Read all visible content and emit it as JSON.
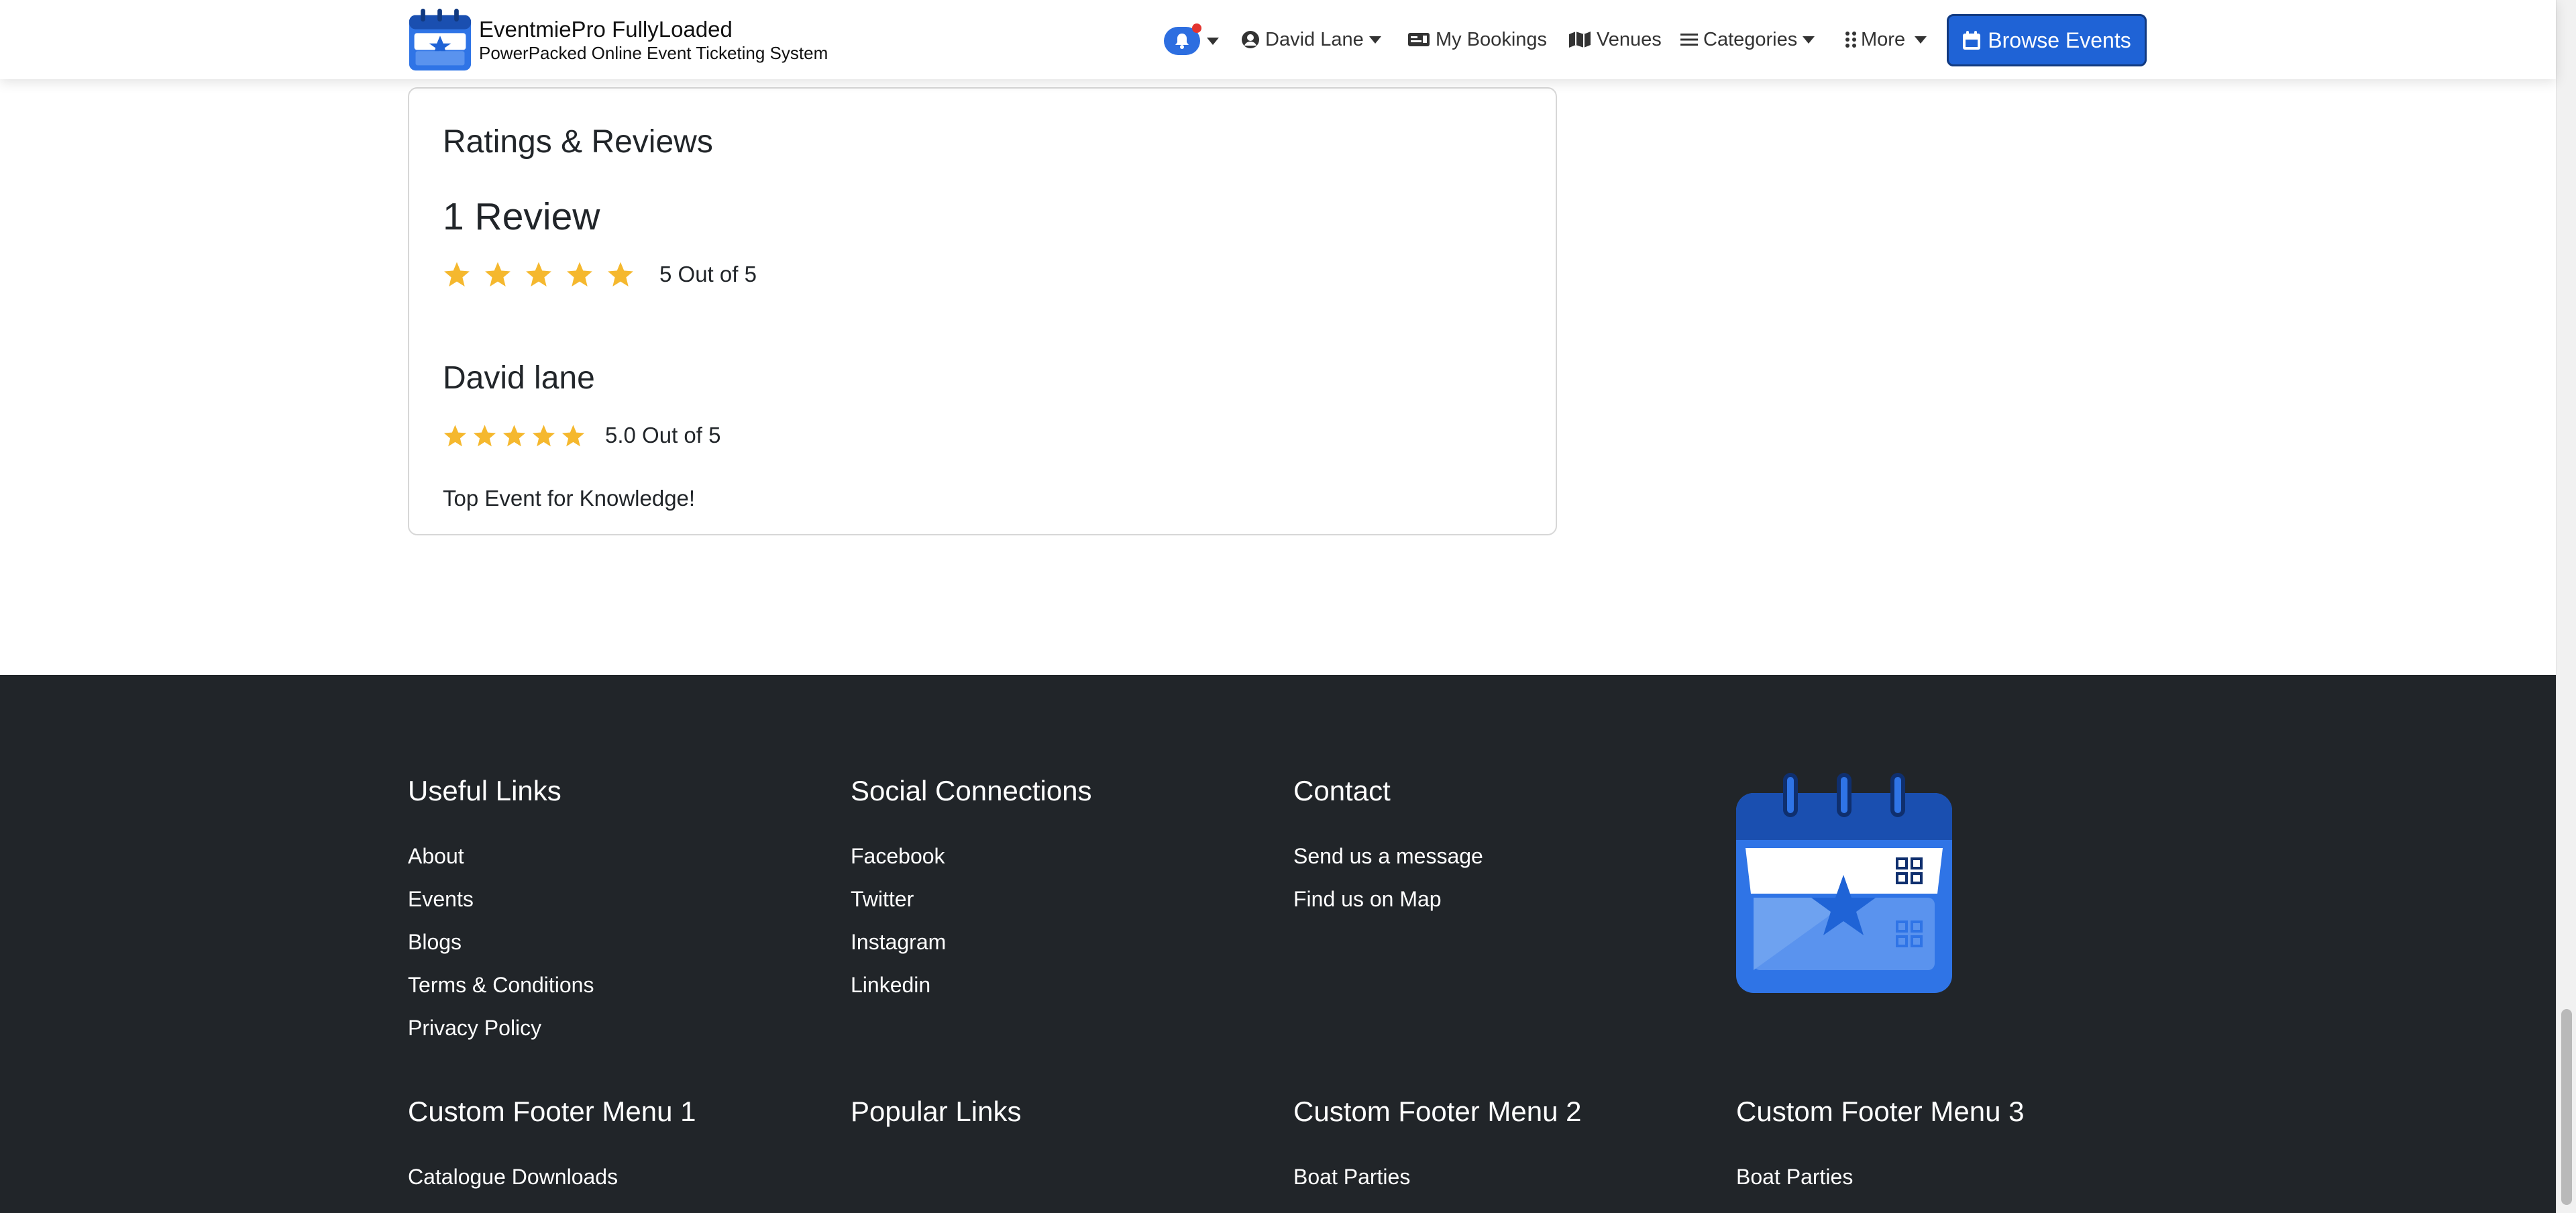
{
  "navbar": {
    "brand_name": "EventmiePro FullyLoaded",
    "brand_tagline": "PowerPacked Online Event Ticketing System",
    "items": {
      "user": "David Lane",
      "bookings": "My Bookings",
      "venues": "Venues",
      "categories": "Categories",
      "more": "More"
    },
    "browse_button": "Browse Events",
    "notification_color": "#2d6ee0",
    "accent_color": "#1f63d6"
  },
  "reviews": {
    "title": "Ratings & Reviews",
    "count_label": "1 Review",
    "overall_rating": 5,
    "overall_text": "5 Out of 5",
    "items": [
      {
        "name": "David lane",
        "rating": 5,
        "rating_text": "5.0 Out of 5",
        "text": "Top Event for Knowledge!"
      }
    ],
    "star_color": "#f5b82e"
  },
  "footer": {
    "background": "#212529",
    "columns_top": [
      {
        "heading": "Useful Links",
        "links": [
          "About",
          "Events",
          "Blogs",
          "Terms & Conditions",
          "Privacy Policy"
        ]
      },
      {
        "heading": "Social Connections",
        "links": [
          "Facebook",
          "Twitter",
          "Instagram",
          "Linkedin"
        ]
      },
      {
        "heading": "Contact",
        "links": [
          "Send us a message",
          "Find us on Map"
        ]
      }
    ],
    "columns_bottom": [
      {
        "heading": "Custom Footer Menu 1",
        "links": [
          "Catalogue Downloads"
        ]
      },
      {
        "heading": "Popular Links",
        "links": []
      },
      {
        "heading": "Custom Footer Menu 2",
        "links": [
          "Boat Parties"
        ]
      },
      {
        "heading": "Custom Footer Menu 3",
        "links": [
          "Boat Parties"
        ]
      }
    ]
  }
}
